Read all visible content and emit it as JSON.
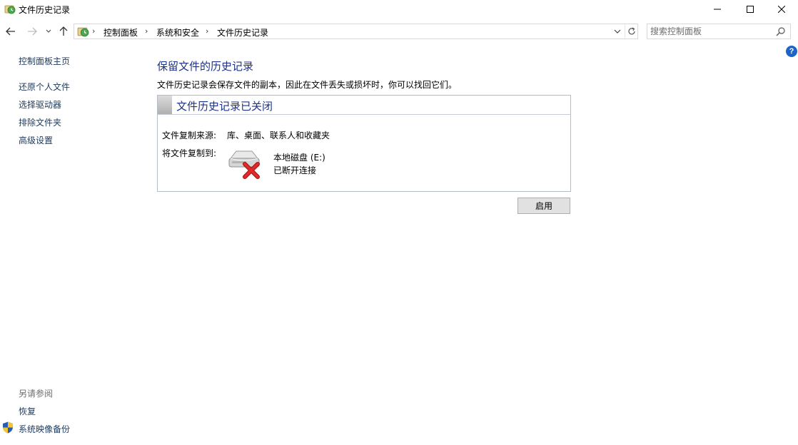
{
  "window": {
    "title": "文件历史记录",
    "app_icon": "file-history-icon"
  },
  "navigation": {
    "back_icon": "arrow-left-icon",
    "forward_icon": "arrow-right-icon",
    "recent_icon": "chevron-down-icon",
    "up_icon": "arrow-up-icon"
  },
  "address_bar": {
    "breadcrumbs": [
      "控制面板",
      "系统和安全",
      "文件历史记录"
    ],
    "refresh_icon": "refresh-icon"
  },
  "search": {
    "placeholder": "搜索控制面板",
    "value": ""
  },
  "left_nav": {
    "home": "控制面板主页",
    "items": [
      "还原个人文件",
      "选择驱动器",
      "排除文件夹",
      "高级设置"
    ],
    "see_also_heading": "另请参阅",
    "see_also_items": [
      "恢复",
      "系统映像备份"
    ]
  },
  "main": {
    "title": "保留文件的历史记录",
    "description": "文件历史记录会保存文件的副本，因此在文件丢失或损坏时，你可以找回它们。",
    "panel": {
      "status_title": "文件历史记录已关闭",
      "source_label": "文件复制来源:",
      "source_value": "库、桌面、联系人和收藏夹",
      "dest_label": "将文件复制到:",
      "drive_name": "本地磁盘 (E:)",
      "drive_status": "已断开连接"
    },
    "enable_button": "启用"
  },
  "colors": {
    "heading_blue": "#1e3287",
    "link_blue": "#1e395b",
    "error_red": "#d21f1f",
    "help_blue": "#1d64c8"
  }
}
